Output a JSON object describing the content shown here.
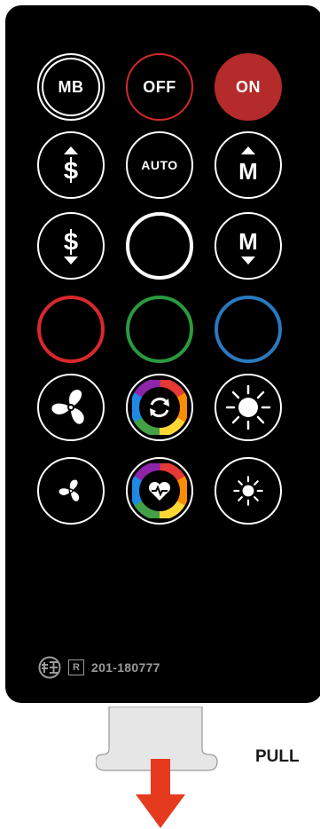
{
  "buttons": {
    "mb": "MB",
    "off": "OFF",
    "on": "ON",
    "auto": "AUTO"
  },
  "certification": {
    "r_mark": "R",
    "number": "201-180777"
  },
  "pull_label": "PULL",
  "colors": {
    "red": "#d8282b",
    "green": "#2a9a3e",
    "blue": "#2b78bf",
    "on_fill": "#b52a2a"
  }
}
